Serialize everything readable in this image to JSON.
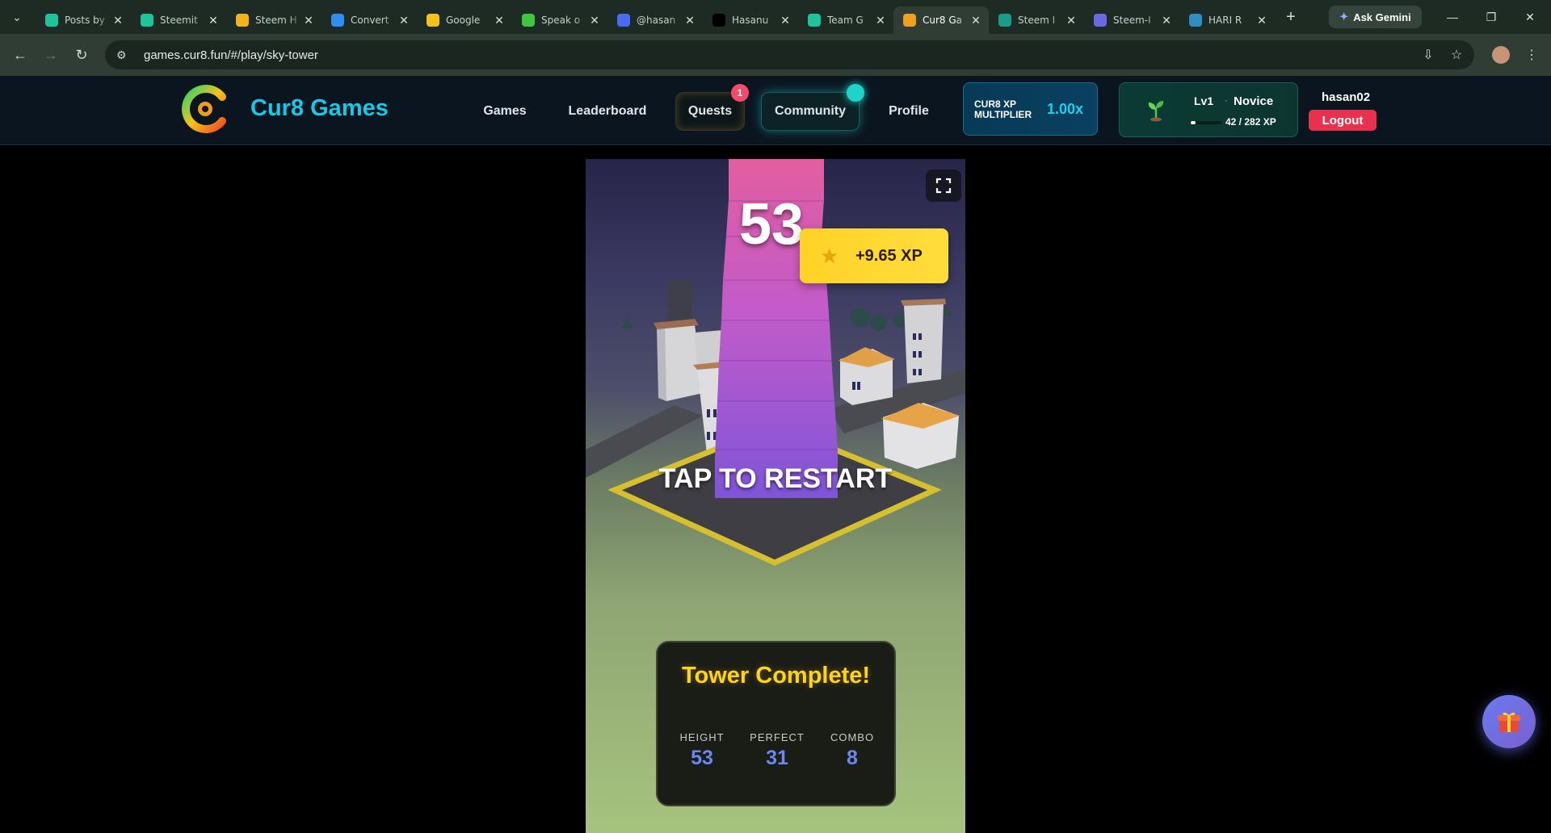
{
  "browser": {
    "tabs": [
      {
        "title": "Posts by",
        "icon": "steemit-icon",
        "color": "#1fc39c"
      },
      {
        "title": "Steemit",
        "icon": "steemit-icon",
        "color": "#1fc39c"
      },
      {
        "title": "Steem H",
        "icon": "emoji-icon",
        "color": "#f3b31a"
      },
      {
        "title": "Convert",
        "icon": "drive-icon",
        "color": "#2f8ff0"
      },
      {
        "title": "Google",
        "icon": "bulb-icon",
        "color": "#f4c21a"
      },
      {
        "title": "Speak o",
        "icon": "play-icon",
        "color": "#3ec63e"
      },
      {
        "title": "@hasan",
        "icon": "profile-icon",
        "color": "#4a6cf0"
      },
      {
        "title": "Hasanu",
        "icon": "x-icon",
        "color": "#000000"
      },
      {
        "title": "Team G",
        "icon": "steemit-icon",
        "color": "#1fc39c"
      },
      {
        "title": "Cur8 Ga",
        "icon": "cur8-icon",
        "color": "#f0a020"
      },
      {
        "title": "Steem I",
        "icon": "steem-icon",
        "color": "#1a9c8c"
      },
      {
        "title": "Steem-I",
        "icon": "steem-icon",
        "color": "#6a6ae0"
      },
      {
        "title": "HARI R",
        "icon": "hari-icon",
        "color": "#2f8fc0"
      }
    ],
    "active_tab": 9,
    "ask_gemini": "Ask Gemini",
    "url": "games.cur8.fun/#/play/sky-tower"
  },
  "header": {
    "brand": "Cur8 Games",
    "nav": [
      "Games",
      "Leaderboard",
      "Quests",
      "Community",
      "Profile"
    ],
    "quests_badge": "1",
    "xp_multiplier_label": "CUR8 XP MULTIPLIER",
    "xp_multiplier_value": "1.00x",
    "level": "Lv1",
    "level_separator": "·",
    "rank": "Novice",
    "xp_progress": "42 / 282 XP",
    "xp_fraction": 0.149,
    "username": "hasan02",
    "logout": "Logout"
  },
  "game": {
    "score": "53",
    "xp_gain": "+9.65 XP",
    "restart_text": "TAP TO RESTART",
    "result_title": "Tower Complete!",
    "stats": [
      {
        "label": "HEIGHT",
        "value": "53"
      },
      {
        "label": "PERFECT",
        "value": "31"
      },
      {
        "label": "COMBO",
        "value": "8"
      }
    ]
  }
}
